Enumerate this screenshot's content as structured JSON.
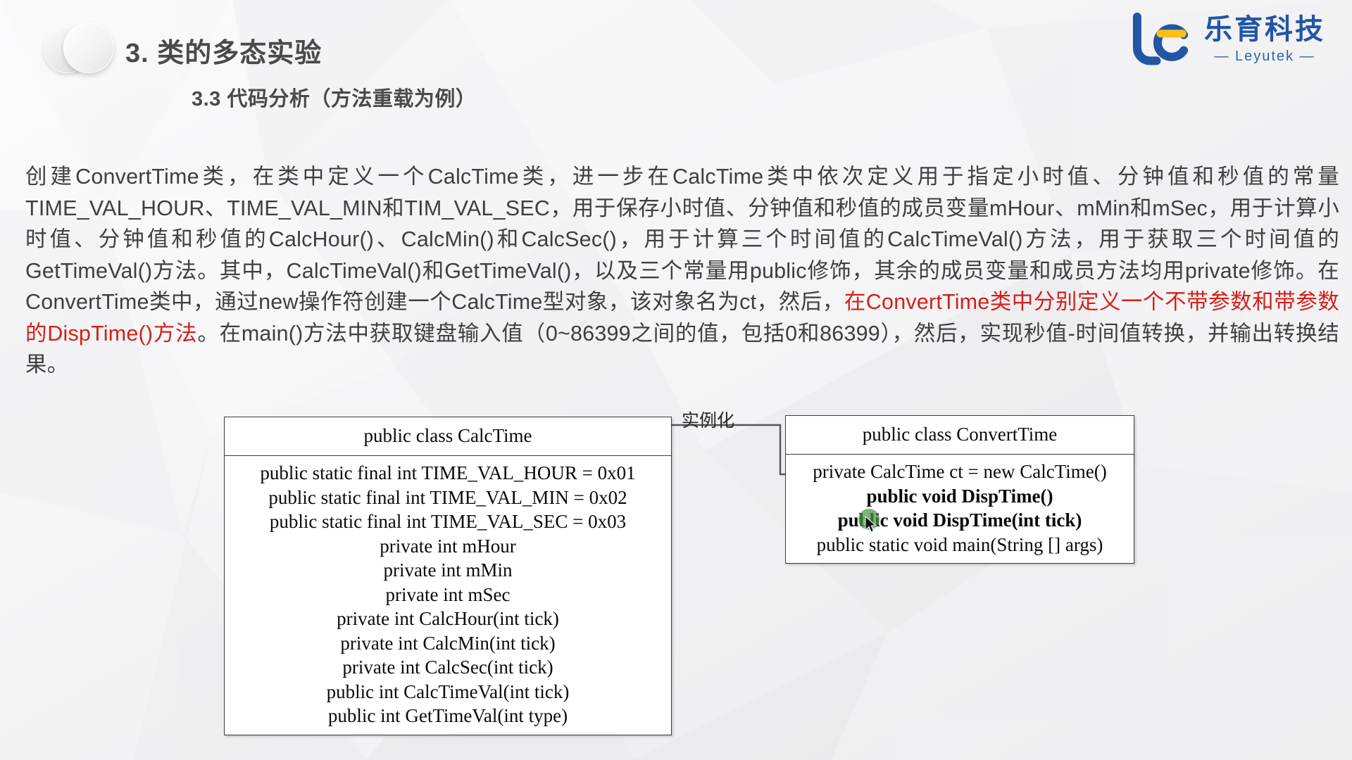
{
  "header": {
    "title": "3. 类的多态实验",
    "subtitle": "3.3 代码分析（方法重载为例）",
    "deco_icon": "double-ring-icon"
  },
  "logo": {
    "mark_icon": "leyutek-bc-logo-icon",
    "cn_name": "乐育科技",
    "en_name": "— Leyutek —",
    "blue": "#2255a4",
    "yellow": "#fcbf18"
  },
  "paragraph": {
    "seg1": "    创建ConvertTime类，在类中定义一个CalcTime类，进一步在CalcTime类中依次定义用于指定小时值、分钟值和秒值的常量TIME_VAL_HOUR、TIME_VAL_MIN和TIM_VAL_SEC，用于保存小时值、分钟值和秒值的成员变量mHour、mMin和mSec，用于计算小时值、分钟值和秒值的CalcHour()、CalcMin()和CalcSec()，用于计算三个时间值的CalcTimeVal()方法，用于获取三个时间值的GetTimeVal()方法。其中，CalcTimeVal()和GetTimeVal()，以及三个常量用public修饰，其余的成员变量和成员方法均用private修饰。在ConvertTime类中，通过new操作符创建一个CalcTime型对象，该对象名为ct，然后，",
    "highlight": "在ConvertTime类中分别定义一个不带参数和带参数的DispTime()方法",
    "seg2": "。在main()方法中获取键盘输入值（0~86399之间的值，包括0和86399），然后，实现秒值-时间值转换，并输出转换结果。",
    "highlight_color": "#d61f18"
  },
  "diagram": {
    "connector_label": "实例化",
    "calc_time_box": {
      "title": "public class CalcTime",
      "members": [
        {
          "text": "public static final int TIME_VAL_HOUR = 0x01",
          "bold": false
        },
        {
          "text": "public static final int TIME_VAL_MIN  = 0x02",
          "bold": false
        },
        {
          "text": "public static final int TIME_VAL_SEC  = 0x03",
          "bold": false
        },
        {
          "text": "private int mHour",
          "bold": false
        },
        {
          "text": "private int mMin",
          "bold": false
        },
        {
          "text": "private int mSec",
          "bold": false
        },
        {
          "text": "private int CalcHour(int tick)",
          "bold": false
        },
        {
          "text": "private int CalcMin(int tick)",
          "bold": false
        },
        {
          "text": "private int CalcSec(int tick)",
          "bold": false
        },
        {
          "text": "public int CalcTimeVal(int tick)",
          "bold": false
        },
        {
          "text": "public int GetTimeVal(int type)",
          "bold": false
        }
      ]
    },
    "convert_time_box": {
      "title": "public class ConvertTime",
      "members": [
        {
          "text": "private CalcTime ct = new CalcTime()",
          "bold": false
        },
        {
          "text": "public void DispTime()",
          "bold": true
        },
        {
          "text": "public void DispTime(int tick)",
          "bold": true
        },
        {
          "text": "public static void main(String [] args)",
          "bold": false
        }
      ]
    }
  },
  "cursor": {
    "icon": "mouse-pointer-icon",
    "highlight_color": "#4a964a"
  }
}
